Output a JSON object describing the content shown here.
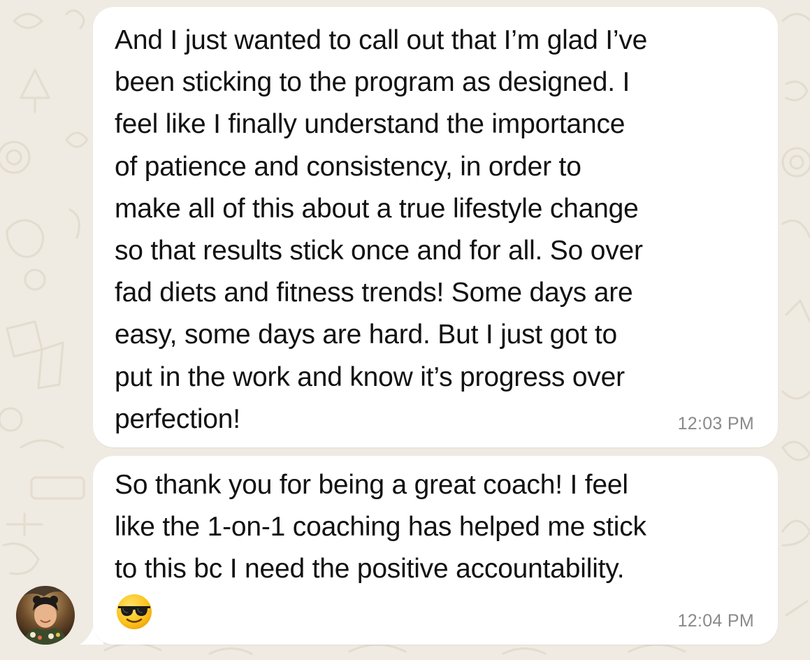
{
  "chat": {
    "messages": [
      {
        "text": "And I just wanted to call out that I’m glad I’ve\nbeen sticking to the program as designed. I\nfeel like I finally understand the importance\nof patience and consistency, in order to\nmake all of this about a true lifestyle change\nso that results stick once and for all. So over\nfad diets and fitness trends! Some days are\neasy, some days are hard. But I just got to\nput in the work and know it’s progress over\nperfection!",
        "time": "12:03 PM"
      },
      {
        "text": "So thank you for being a great coach! I feel\nlike the 1-on-1 coaching has helped me stick\nto this bc I need the positive accountability.",
        "emoji": "sunglasses-face",
        "time": "12:04 PM"
      }
    ]
  },
  "icons": {
    "sender_avatar": "avatar-photo",
    "message_emoji": "smiling-face-with-sunglasses"
  },
  "colors": {
    "wallpaper": "#efeae2",
    "bubble": "#ffffff",
    "text": "#111111",
    "timestamp": "#8a8a8a"
  }
}
